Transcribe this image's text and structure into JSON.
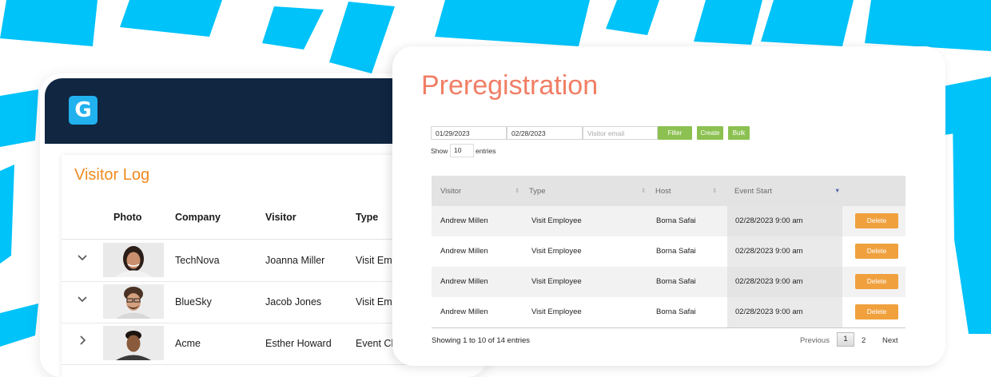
{
  "colors": {
    "decor_blue": "#00c3f9",
    "app_header": "#102641",
    "logo_bg": "#21b1ee",
    "visitor_log_title": "#f08a1f",
    "prereg_title": "#f07e65",
    "green_button": "#8cc152",
    "delete_button": "#f0a13e"
  },
  "visitor_log": {
    "logo_letter": "G",
    "title": "Visitor Log",
    "columns": {
      "photo": "Photo",
      "company": "Company",
      "visitor": "Visitor",
      "type": "Type"
    },
    "rows": [
      {
        "company": "TechNova",
        "visitor": "Joanna Miller",
        "type": "Visit Emp"
      },
      {
        "company": "BlueSky",
        "visitor": "Jacob Jones",
        "type": "Visit Emp"
      },
      {
        "company": "Acme",
        "visitor": "Esther Howard",
        "type": "Event Ch"
      }
    ]
  },
  "preregistration": {
    "title": "Preregistration",
    "filters": {
      "date_from": "01/29/2023",
      "date_to": "02/28/2023",
      "email_placeholder": "Visitor email",
      "filter_label": "Filter",
      "create_label": "Create",
      "bulk_label": "Bulk"
    },
    "show": {
      "prefix": "Show",
      "value": "10",
      "suffix": "entries"
    },
    "columns": {
      "visitor": "Visitor",
      "type": "Type",
      "host": "Host",
      "event_start": "Event Start"
    },
    "rows": [
      {
        "visitor": "Andrew Millen",
        "type": "Visit Employee",
        "host": "Borna Safai",
        "event_start": "02/28/2023 9:00 am",
        "action": "Delete"
      },
      {
        "visitor": "Andrew Millen",
        "type": "Visit Employee",
        "host": "Borna Safai",
        "event_start": "02/28/2023 9:00 am",
        "action": "Delete"
      },
      {
        "visitor": "Andrew Millen",
        "type": "Visit Employee",
        "host": "Borna Safai",
        "event_start": "02/28/2023 9:00 am",
        "action": "Delete"
      },
      {
        "visitor": "Andrew Millen",
        "type": "Visit Employee",
        "host": "Borna Safai",
        "event_start": "02/28/2023 9:00 am",
        "action": "Delete"
      }
    ],
    "footer": {
      "info": "Showing 1 to 10 of 14 entries",
      "previous": "Previous",
      "pages": [
        "1",
        "2"
      ],
      "next": "Next"
    }
  }
}
